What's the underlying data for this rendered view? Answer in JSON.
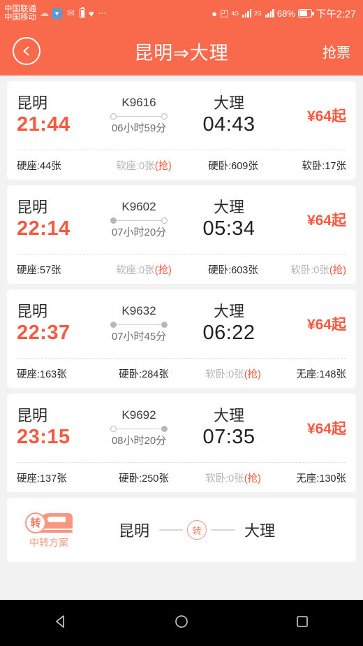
{
  "statusbar": {
    "carrier_top": "中国联通",
    "carrier_bottom": "中国移动",
    "icons": [
      "cloud-icon",
      "health-app-icon",
      "message-icon",
      "battery-saver-icon",
      "heart-rate-icon",
      "more-dots-icon"
    ],
    "location_icon": "location-pin-icon",
    "wifi_icon": "wifi-icon",
    "net1_label": "4G",
    "net2_label": "2G",
    "battery_percent": "68%",
    "clock": "下午2:27"
  },
  "header": {
    "back_icon": "chevron-left-icon",
    "title": "昆明⇒大理",
    "grab_label": "抢票"
  },
  "colors": {
    "accent": "#F96A4D",
    "price": "#F9593F",
    "depart_time": "#F9593F",
    "dim_text": "#b4b4b4",
    "page_bg": "#f2f2f2"
  },
  "trains": [
    {
      "from": "昆明",
      "depart": "21:44",
      "train_no": "K9616",
      "duration": "06小时59分",
      "to": "大理",
      "arrive": "04:43",
      "price": "¥64起",
      "dot_left_filled": false,
      "dot_right_filled": false,
      "seats": [
        {
          "label": "硬座:44张",
          "sold_out": false,
          "grab": ""
        },
        {
          "label": "软座:0张",
          "sold_out": true,
          "grab": "(抢)"
        },
        {
          "label": "硬卧:609张",
          "sold_out": false,
          "grab": ""
        },
        {
          "label": "软卧:17张",
          "sold_out": false,
          "grab": ""
        }
      ]
    },
    {
      "from": "昆明",
      "depart": "22:14",
      "train_no": "K9602",
      "duration": "07小时20分",
      "to": "大理",
      "arrive": "05:34",
      "price": "¥64起",
      "dot_left_filled": true,
      "dot_right_filled": false,
      "seats": [
        {
          "label": "硬座:57张",
          "sold_out": false,
          "grab": ""
        },
        {
          "label": "软座:0张",
          "sold_out": true,
          "grab": "(抢)"
        },
        {
          "label": "硬卧:603张",
          "sold_out": false,
          "grab": ""
        },
        {
          "label": "软卧:0张",
          "sold_out": true,
          "grab": "(抢)"
        }
      ]
    },
    {
      "from": "昆明",
      "depart": "22:37",
      "train_no": "K9632",
      "duration": "07小时45分",
      "to": "大理",
      "arrive": "06:22",
      "price": "¥64起",
      "dot_left_filled": true,
      "dot_right_filled": true,
      "seats": [
        {
          "label": "硬座:163张",
          "sold_out": false,
          "grab": ""
        },
        {
          "label": "硬卧:284张",
          "sold_out": false,
          "grab": ""
        },
        {
          "label": "软卧:0张",
          "sold_out": true,
          "grab": "(抢)"
        },
        {
          "label": "无座:148张",
          "sold_out": false,
          "grab": ""
        }
      ]
    },
    {
      "from": "昆明",
      "depart": "23:15",
      "train_no": "K9692",
      "duration": "08小时20分",
      "to": "大理",
      "arrive": "07:35",
      "price": "¥64起",
      "dot_left_filled": false,
      "dot_right_filled": true,
      "seats": [
        {
          "label": "硬座:137张",
          "sold_out": false,
          "grab": ""
        },
        {
          "label": "硬卧:250张",
          "sold_out": false,
          "grab": ""
        },
        {
          "label": "软卧:0张",
          "sold_out": true,
          "grab": "(抢)"
        },
        {
          "label": "无座:130张",
          "sold_out": false,
          "grab": ""
        }
      ]
    }
  ],
  "transfer": {
    "badge_char": "转",
    "badge_label": "中转方案",
    "from": "昆明",
    "mid_char": "转",
    "to": "大理"
  },
  "navbar": {
    "back": "back-triangle-icon",
    "home": "home-circle-icon",
    "recents": "recents-square-icon"
  }
}
